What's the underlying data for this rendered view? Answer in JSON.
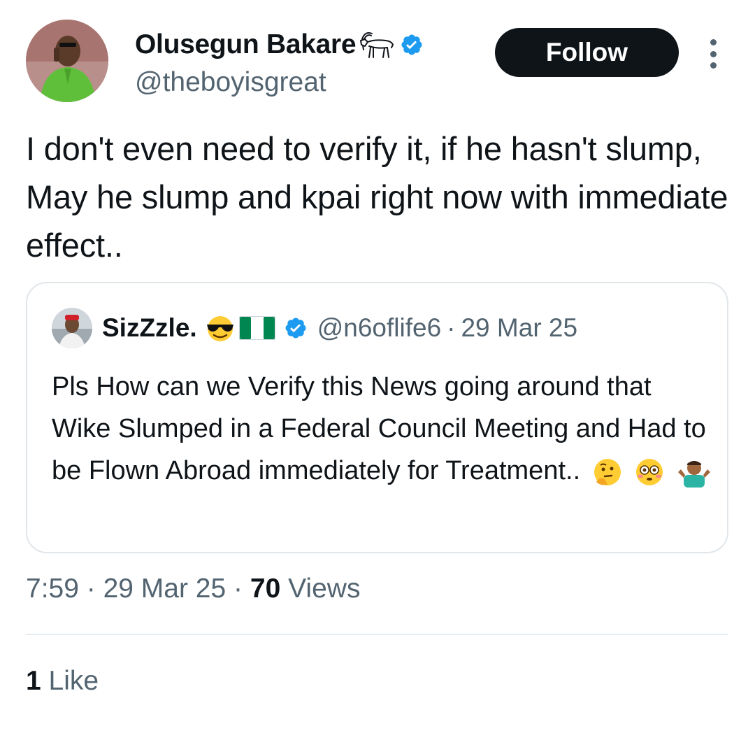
{
  "author": {
    "display_name": "Olusegun Bakare",
    "handle": "@theboyisgreat",
    "verified": true,
    "name_emoji": "goat-icon"
  },
  "follow_button": {
    "label": "Follow"
  },
  "more_button": {
    "icon": "more-vertical-icon"
  },
  "tweet": {
    "text": "I don't even need to verify it, if he hasn't slump, May he slump and kpai right now with immediate effect.."
  },
  "quoted_tweet": {
    "display_name": "SizZzle.",
    "name_emojis": [
      "sunglasses-face-icon",
      "nigeria-flag-icon"
    ],
    "verified": true,
    "handle": "@n6oflife6",
    "separator": "·",
    "date": "29 Mar 25",
    "text": "Pls How can we Verify this News going around that Wike Slumped in a Federal Council Meeting and Had to be Flown Abroad immediately for Treatment..",
    "trailing_emojis": [
      "thinking-face-icon",
      "flushed-face-icon",
      "man-shrugging-icon"
    ]
  },
  "meta": {
    "time": "7:59",
    "sep1": "·",
    "date": "29 Mar 25",
    "sep2": "·",
    "views_count": "70",
    "views_label": "Views"
  },
  "engagement": {
    "like_count": "1",
    "like_label": "Like"
  },
  "colors": {
    "text_primary": "#0f1419",
    "text_secondary": "#536471",
    "verified_blue": "#1d9bf0",
    "border": "#e1e6ea"
  }
}
